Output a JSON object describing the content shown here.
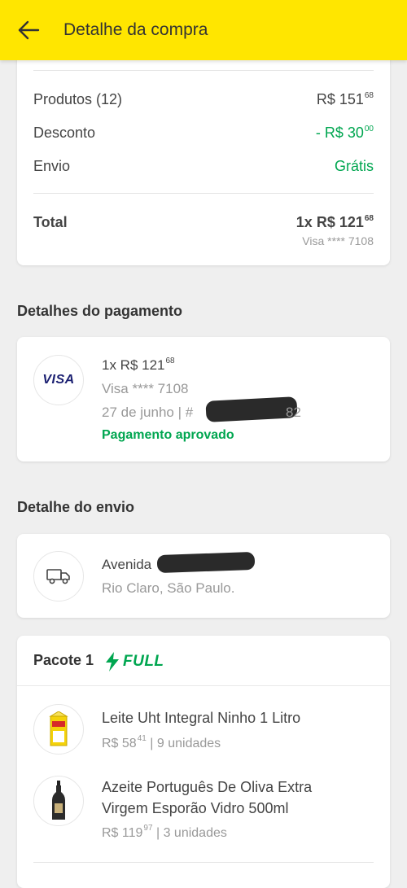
{
  "header": {
    "title": "Detalhe da compra",
    "back_icon": "arrow-left-icon",
    "background": "#ffe600"
  },
  "summary": {
    "products_label": "Produtos (12)",
    "products_value": "R$ 151",
    "products_cents": "68",
    "discount_label": "Desconto",
    "discount_value": "- R$ 30",
    "discount_cents": "00",
    "shipping_label": "Envio",
    "shipping_value": "Grátis",
    "total_label": "Total",
    "total_value": "1x R$ 121",
    "total_cents": "68",
    "total_card": "Visa **** 7108"
  },
  "payment": {
    "section_title": "Detalhes do pagamento",
    "brand": "VISA",
    "amount": "1x R$ 121",
    "amount_cents": "68",
    "card": "Visa **** 7108",
    "date": "27 de junho  |  #",
    "id_suffix": "82",
    "status": "Pagamento aprovado"
  },
  "shipping": {
    "section_title": "Detalhe do envio",
    "icon": "truck-icon",
    "address_prefix": "Avenida",
    "city": "Rio Claro, São Paulo."
  },
  "package": {
    "title": "Pacote 1",
    "badge": "FULL",
    "items": [
      {
        "name": "Leite Uht Integral Ninho 1 Litro",
        "price": "R$ 58",
        "cents": "41",
        "qty": " | 9 unidades"
      },
      {
        "name_line1": "Azeite Português De Oliva Extra",
        "name_line2": "Virgem Esporão Vidro 500ml",
        "price": "R$ 119",
        "cents": "97",
        "qty": " | 3 unidades"
      }
    ]
  },
  "colors": {
    "accent_yellow": "#ffe600",
    "green": "#00a650",
    "visa_blue": "#1a1f71"
  }
}
